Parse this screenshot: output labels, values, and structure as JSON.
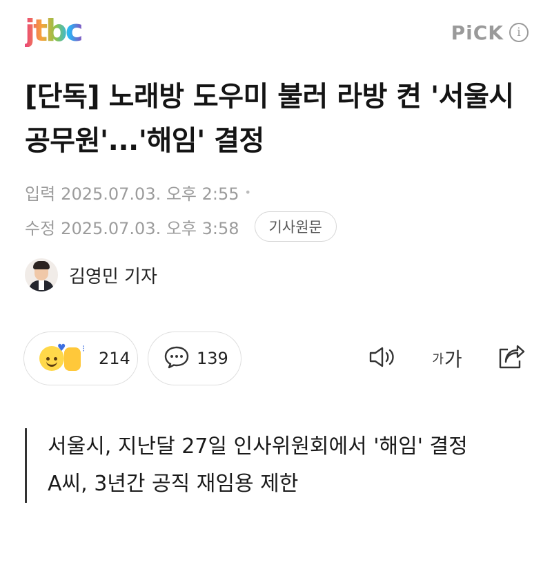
{
  "header": {
    "logo_text": "jtbc",
    "pick_label": "PiCK",
    "info_icon": "info-icon"
  },
  "article": {
    "headline": "[단독] 노래방 도우미 불러 라방 켠 '서울시 공무원'...'해임' 결정",
    "input_label": "입력",
    "input_datetime": "2025.07.03. 오후 2:55",
    "modified_label": "수정",
    "modified_datetime": "2025.07.03. 오후 3:58",
    "original_button": "기사원문",
    "reporter": "김영민 기자"
  },
  "actions": {
    "reaction_count": "214",
    "comment_count": "139",
    "font_small": "가",
    "font_big": "가"
  },
  "summary": {
    "lines": [
      "서울시, 지난달 27일 인사위원회에서 '해임' 결정",
      "A씨, 3년간 공직 재임용 제한"
    ]
  },
  "colors": {
    "meta_gray": "#9c9c9c",
    "border_gray": "#dddddd",
    "text_dark": "#141414"
  }
}
